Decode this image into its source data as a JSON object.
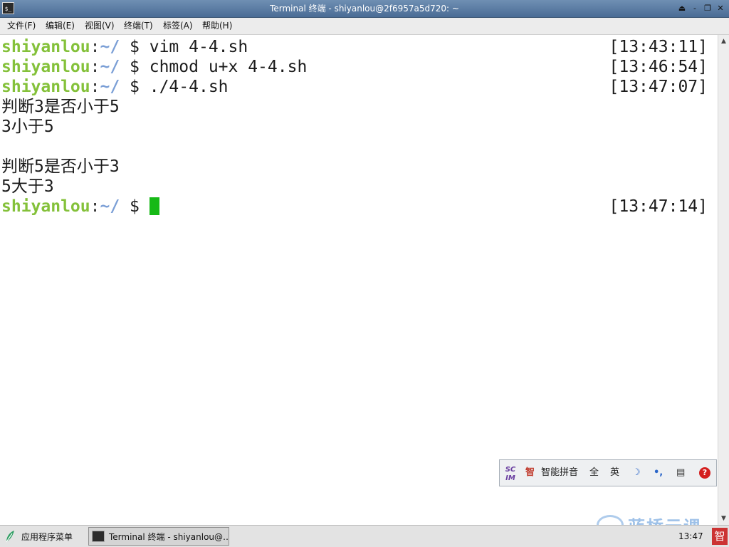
{
  "window": {
    "title": "Terminal 终端 - shiyanlou@2f6957a5d720: ~",
    "app_icon": "$_",
    "buttons": {
      "shade": "⏏",
      "minimize": "-",
      "maximize": "❐",
      "close": "✕"
    }
  },
  "menubar": {
    "items": [
      "文件(F)",
      "编辑(E)",
      "视图(V)",
      "终端(T)",
      "标签(A)",
      "帮助(H)"
    ]
  },
  "terminal": {
    "prompt": {
      "user": "shiyanlou",
      "colon": ":",
      "path": "~/",
      "symbol": " $ "
    },
    "lines": [
      {
        "type": "prompt",
        "command": "vim 4-4.sh",
        "time": "[13:43:11]"
      },
      {
        "type": "prompt",
        "command": "chmod u+x 4-4.sh",
        "time": "[13:46:54]"
      },
      {
        "type": "prompt",
        "command": "./4-4.sh",
        "time": "[13:47:07]"
      },
      {
        "type": "output",
        "text": "判断3是否小于5"
      },
      {
        "type": "output",
        "text": "3小于5"
      },
      {
        "type": "output",
        "text": ""
      },
      {
        "type": "output",
        "text": "判断5是否小于3"
      },
      {
        "type": "output",
        "text": "5大于3"
      },
      {
        "type": "prompt",
        "command": "",
        "time": "[13:47:14]",
        "cursor": true
      }
    ],
    "cursor_color": "#16b916"
  },
  "ime": {
    "logo": "SC IM",
    "mode_icon": "智",
    "name": "智能拼音",
    "width": "全",
    "lang": "英",
    "icons": [
      "moon-icon",
      "punctuation-icon",
      "keyboard-icon",
      "help-icon"
    ]
  },
  "taskbar": {
    "start_label": "应用程序菜单",
    "task_label": "Terminal 终端 - shiyanlou@…",
    "clock": "13:47",
    "tray_icon": "智"
  },
  "watermark": {
    "text": "蓝桥云课"
  },
  "colors": {
    "prompt_user": "#84c13a",
    "prompt_path": "#7b9fd6",
    "titlebar": "#4a6c95"
  }
}
